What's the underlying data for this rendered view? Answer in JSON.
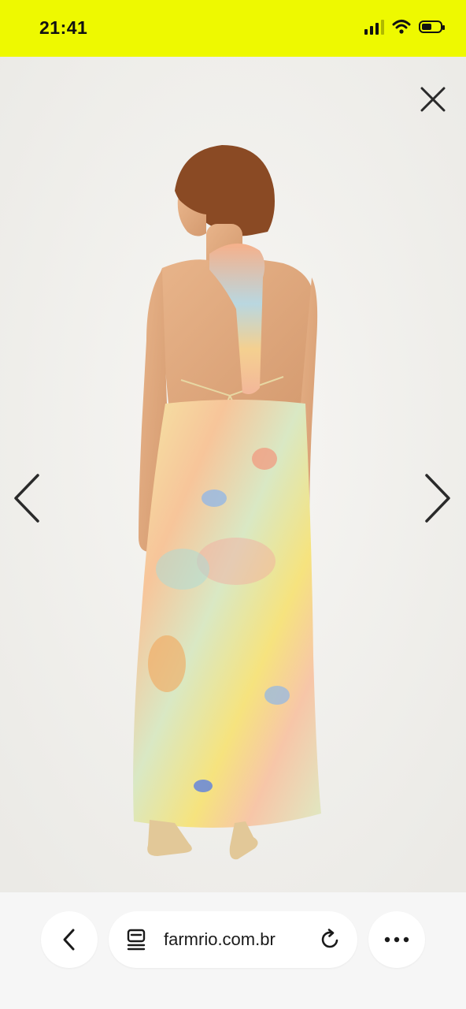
{
  "status_bar": {
    "time": "21:41",
    "icons": [
      "cellular-signal-icon",
      "wifi-icon",
      "battery-icon"
    ],
    "battery_level": 0.55,
    "background_color": "#eef900"
  },
  "viewer": {
    "image": "product-photo-back-view-halter-maxi-dress",
    "close_icon": "close-icon",
    "prev_icon": "chevron-left-icon",
    "next_icon": "chevron-right-icon"
  },
  "browser_bar": {
    "back_icon": "chevron-left-icon",
    "page_icon": "page-info-icon",
    "url": "farmrio.com.br",
    "reload_icon": "reload-icon",
    "more_icon": "more-icon"
  }
}
